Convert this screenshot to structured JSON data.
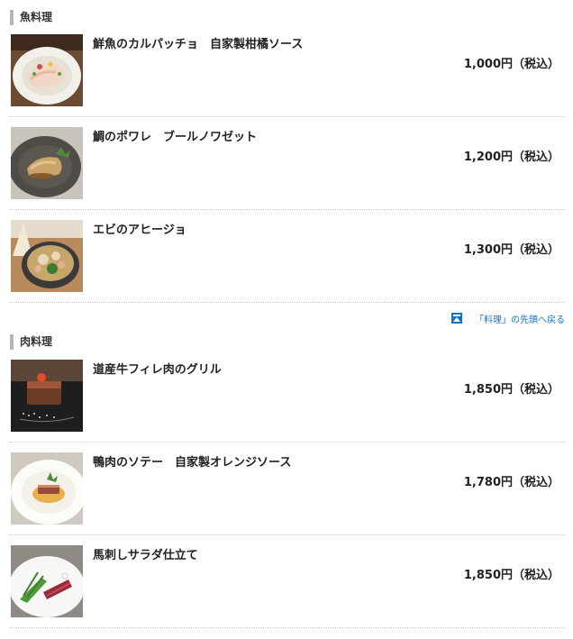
{
  "sections": [
    {
      "title": "魚料理",
      "items": [
        {
          "name": "鮮魚のカルパッチョ　自家製柑橘ソース",
          "price": "1,000円（税込）",
          "image": "carpaccio-photo"
        },
        {
          "name": "鯛のポワレ　ブールノワゼット",
          "price": "1,200円（税込）",
          "image": "sea-bream-poele-photo"
        },
        {
          "name": "エビのアヒージョ",
          "price": "1,300円（税込）",
          "image": "shrimp-ajillo-photo"
        }
      ]
    },
    {
      "title": "肉料理",
      "items": [
        {
          "name": "道産牛フィレ肉のグリル",
          "price": "1,850円（税込）",
          "image": "beef-fillet-photo"
        },
        {
          "name": "鴨肉のソテー　自家製オレンジソース",
          "price": "1,780円（税込）",
          "image": "duck-saute-photo"
        },
        {
          "name": "馬刺しサラダ仕立て",
          "price": "1,850円（税込）",
          "image": "horse-sashimi-salad-photo"
        }
      ]
    }
  ],
  "back_link": {
    "label": "「料理」の先頭へ戻る",
    "icon": "arrow-up-to-top-icon"
  }
}
